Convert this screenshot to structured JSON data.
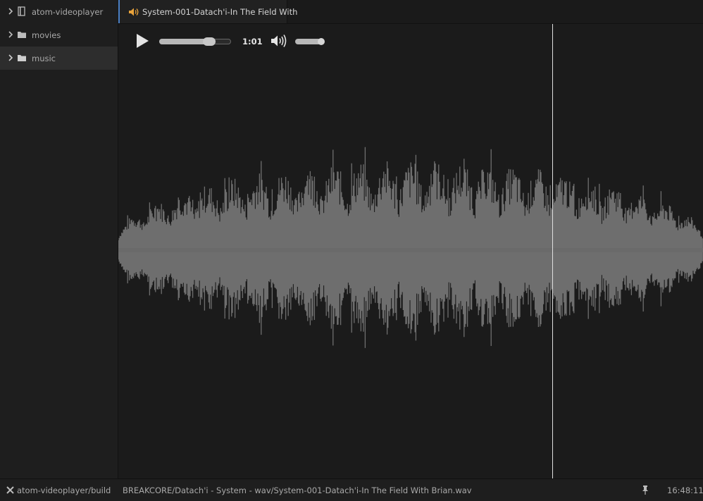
{
  "sidebar": {
    "items": [
      {
        "label": "atom-videoplayer",
        "icon": "repo-icon",
        "selected": false
      },
      {
        "label": "movies",
        "icon": "folder-icon",
        "selected": false
      },
      {
        "label": "music",
        "icon": "folder-icon",
        "selected": true
      }
    ]
  },
  "tab": {
    "label": "System-001-Datach'i-In The Field With",
    "icon": "speaker-icon"
  },
  "player": {
    "time": "1:01",
    "progress": 0.7,
    "volume": 0.85,
    "playhead_fraction": 0.742
  },
  "statusbar": {
    "project": "atom-videoplayer/build",
    "path": "BREAKCORE/Datach'i - System - wav/System-001-Datach'i-In The Field With Brian.wav",
    "clock": "16:48:11"
  },
  "colors": {
    "accent_tab": "#4a7fc4",
    "speaker_icon": "#e8a33b",
    "waveform": "#6e6e6e",
    "playhead": "#e0e0e0"
  }
}
